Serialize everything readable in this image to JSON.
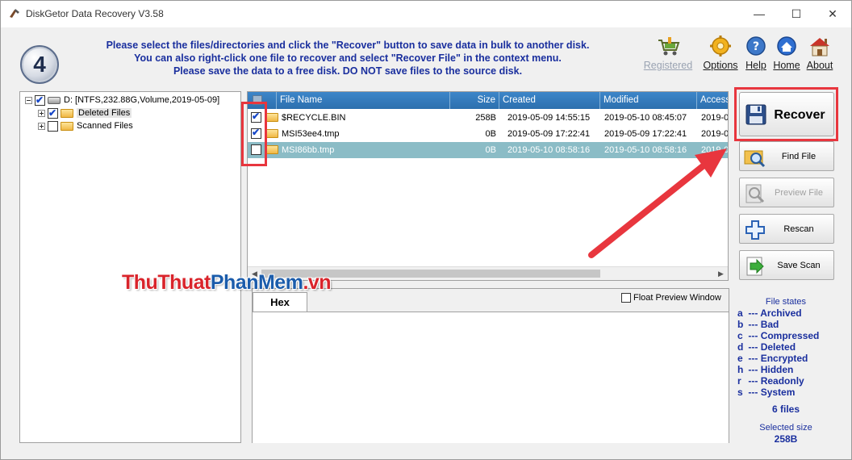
{
  "window": {
    "title": "DiskGetor Data Recovery V3.58",
    "controls": {
      "minimize": "—",
      "maximize": "☐",
      "close": "✕"
    }
  },
  "step_number": "4",
  "instructions": [
    "Please select the files/directories and click the \"Recover\" button to save data in bulk to another disk.",
    "You can also right-click one file to recover and select \"Recover File\" in the context menu.",
    "Please save the data to a free disk. DO NOT save files to the source disk."
  ],
  "top_links": {
    "registered": "Registered",
    "options": "Options",
    "help": "Help",
    "home": "Home",
    "about": "About"
  },
  "tree": {
    "root": "D:  [NTFS,232.88G,Volume,2019-05-09]",
    "deleted": "Deleted Files",
    "scanned": "Scanned Files"
  },
  "file_list": {
    "columns": [
      "File Name",
      "Size",
      "Created",
      "Modified",
      "Accesse"
    ],
    "rows": [
      {
        "name": "$RECYCLE.BIN",
        "size": "258B",
        "created": "2019-05-09 14:55:15",
        "modified": "2019-05-10 08:45:07",
        "accessed": "2019-0",
        "checked": true
      },
      {
        "name": "MSI53ee4.tmp",
        "size": "0B",
        "created": "2019-05-09 17:22:41",
        "modified": "2019-05-09 17:22:41",
        "accessed": "2019-0",
        "checked": true
      },
      {
        "name": "MSI86bb.tmp",
        "size": "0B",
        "created": "2019-05-10 08:58:16",
        "modified": "2019-05-10 08:58:16",
        "accessed": "2019-0",
        "checked": false
      }
    ]
  },
  "preview": {
    "tab": "Hex",
    "float_label": "Float Preview Window"
  },
  "actions": {
    "recover": "Recover",
    "find_file": "Find File",
    "preview_file": "Preview File",
    "rescan": "Rescan",
    "save_scan": "Save Scan"
  },
  "file_states": {
    "title": "File states",
    "items": [
      {
        "key": "a",
        "label": "Archived"
      },
      {
        "key": "b",
        "label": "Bad"
      },
      {
        "key": "c",
        "label": "Compressed"
      },
      {
        "key": "d",
        "label": "Deleted"
      },
      {
        "key": "e",
        "label": "Encrypted"
      },
      {
        "key": "h",
        "label": "Hidden"
      },
      {
        "key": "r",
        "label": "Readonly"
      },
      {
        "key": "s",
        "label": "System"
      }
    ],
    "separator": "---"
  },
  "summary": {
    "file_count": "6 files",
    "selected_label": "Selected size",
    "selected_value": "258B"
  },
  "watermark": {
    "part1": "ThuThuat",
    "part2": "PhanMem",
    "part3": ".vn"
  },
  "colors": {
    "header_blue": "#2c6fae",
    "instruction_text": "#1a2f9e",
    "highlight_red": "#e8363e",
    "selected_row": "#8bbcc6"
  }
}
